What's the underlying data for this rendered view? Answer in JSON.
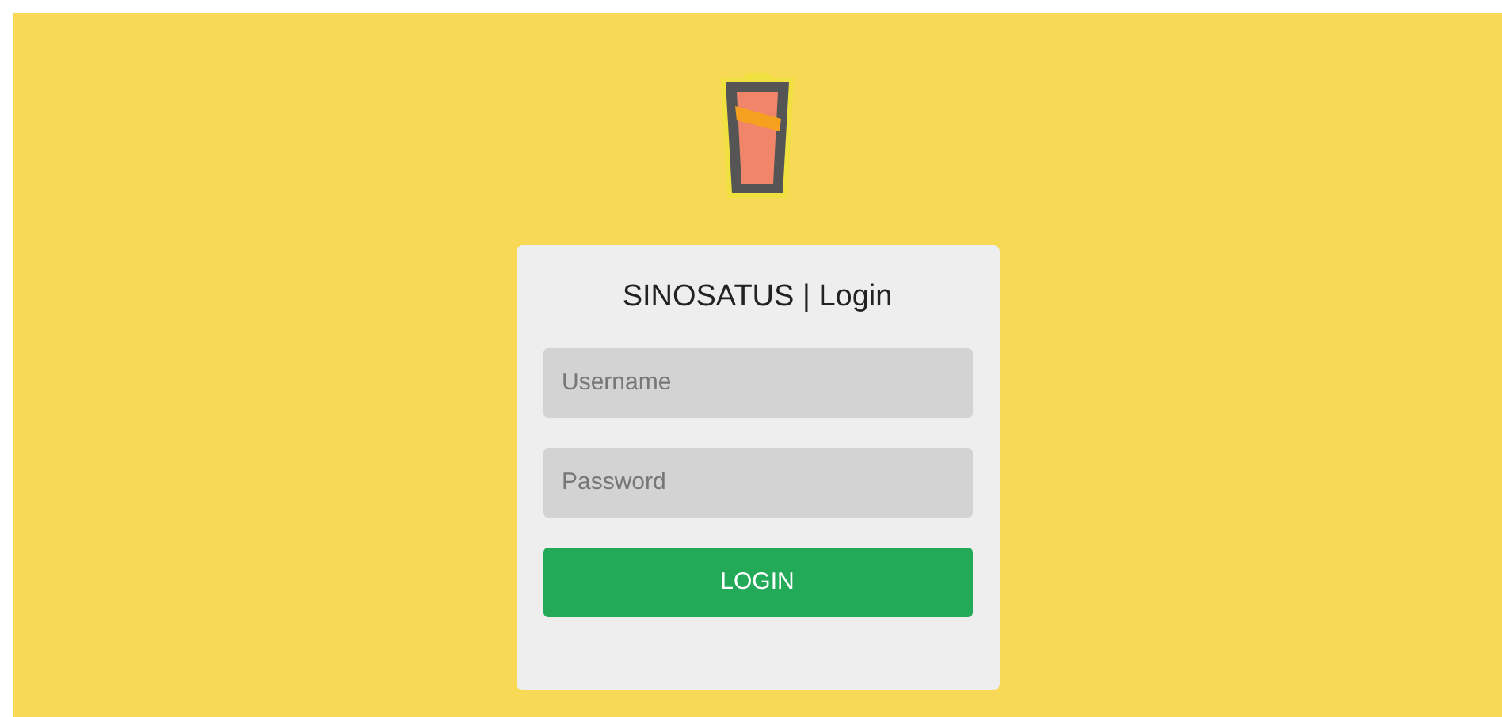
{
  "login_card": {
    "title": "SINOSATUS | Login",
    "fields": [
      {
        "placeholder": "Username"
      },
      {
        "placeholder": "Password"
      }
    ],
    "submit_button": "LOGIN"
  }
}
